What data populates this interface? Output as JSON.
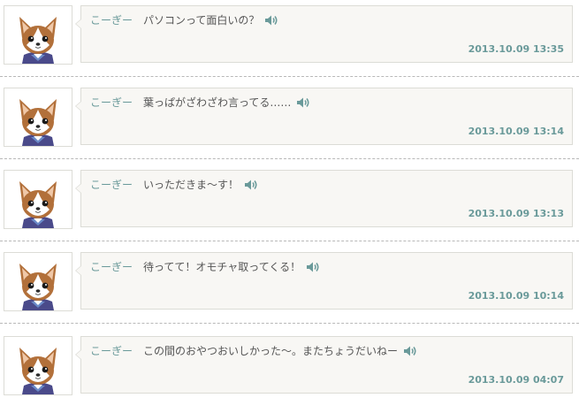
{
  "posts": [
    {
      "author": "こーぎー",
      "message": "パソコンって面白いの？",
      "timestamp": "2013.10.09 13:35"
    },
    {
      "author": "こーぎー",
      "message": "葉っぱがざわざわ言ってる……",
      "timestamp": "2013.10.09 13:14"
    },
    {
      "author": "こーぎー",
      "message": "いっただきま～す！",
      "timestamp": "2013.10.09 13:13"
    },
    {
      "author": "こーぎー",
      "message": "待ってて！オモチャ取ってくる！",
      "timestamp": "2013.10.09 10:14"
    },
    {
      "author": "こーぎー",
      "message": "この間のおやつおいしかった～。またちょうだいねー",
      "timestamp": "2013.10.09 04:07"
    }
  ],
  "icons": {
    "avatar": "corgi-avatar",
    "speaker": "speaker-icon"
  },
  "colors": {
    "accent": "#6a9a9a",
    "text": "#555555",
    "bubble_bg": "#f8f7f4",
    "border": "#dcdcd6"
  }
}
